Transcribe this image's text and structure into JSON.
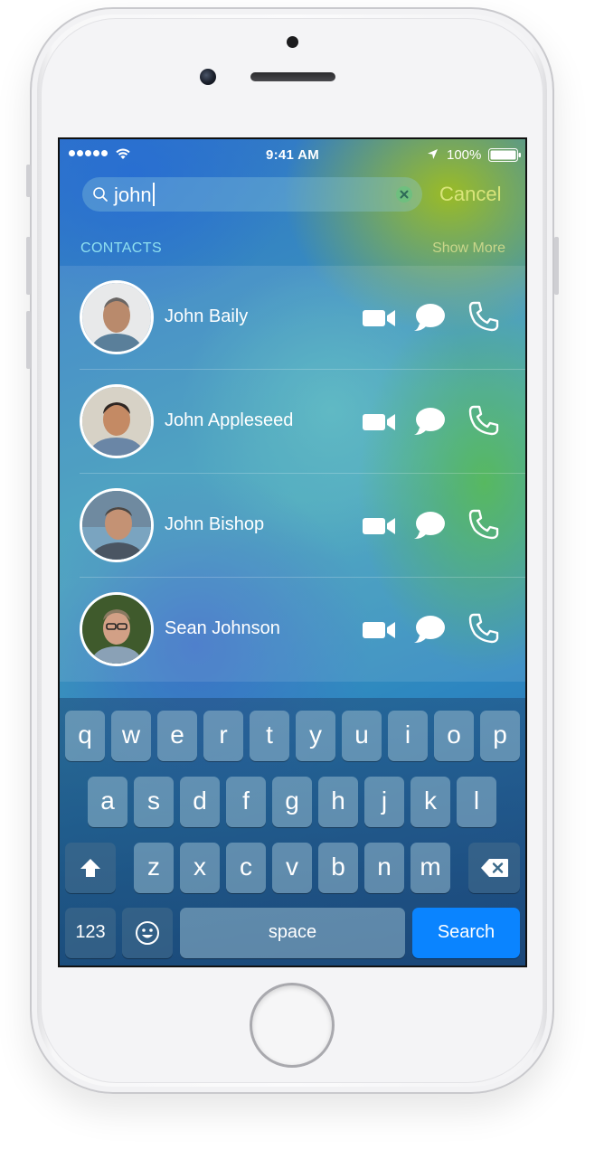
{
  "status_bar": {
    "time": "9:41 AM",
    "battery": "100%"
  },
  "search": {
    "query": "john",
    "cancel_label": "Cancel"
  },
  "contacts_section": {
    "header": "CONTACTS",
    "show_more_label": "Show More",
    "items": [
      {
        "name": "John Baily"
      },
      {
        "name": "John Appleseed"
      },
      {
        "name": "John Bishop"
      },
      {
        "name": "Sean Johnson"
      }
    ]
  },
  "keyboard": {
    "row1": [
      "q",
      "w",
      "e",
      "r",
      "t",
      "y",
      "u",
      "i",
      "o",
      "p"
    ],
    "row2": [
      "a",
      "s",
      "d",
      "f",
      "g",
      "h",
      "j",
      "k",
      "l"
    ],
    "row3": [
      "z",
      "x",
      "c",
      "v",
      "b",
      "n",
      "m"
    ],
    "numbers_label": "123",
    "space_label": "space",
    "search_label": "Search"
  },
  "colors": {
    "accent_blue": "#0a84ff",
    "cancel_color": "#d9e57a",
    "section_header_color": "#8fe0f0"
  },
  "icons": [
    "wifi-icon",
    "location-icon",
    "battery-icon",
    "search-icon",
    "clear-icon",
    "video-call-icon",
    "message-icon",
    "phone-call-icon",
    "shift-icon",
    "backspace-icon",
    "emoji-icon"
  ]
}
